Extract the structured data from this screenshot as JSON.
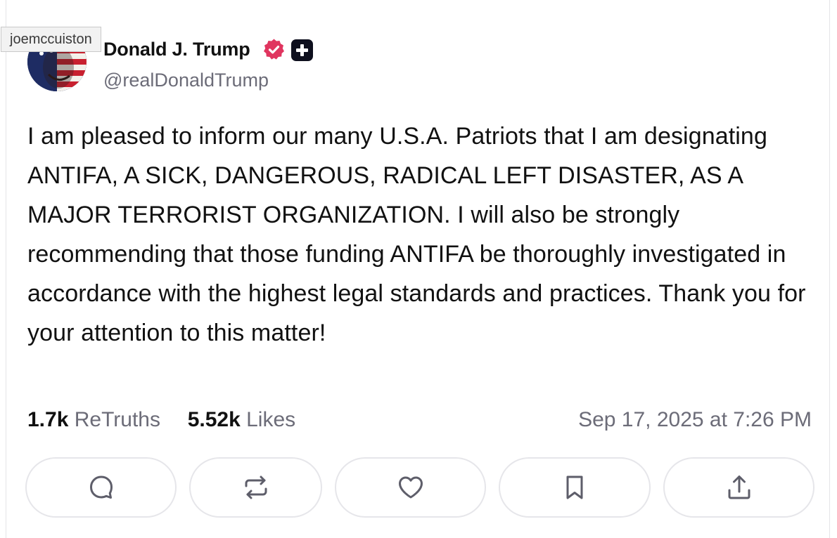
{
  "tooltip": {
    "text": "joemccuiston"
  },
  "author": {
    "display_name": "Donald J. Trump",
    "handle": "@realDonaldTrump",
    "verified_color": "#e0355f"
  },
  "post": {
    "text": "I am pleased to inform our many U.S.A. Patriots that I am designating ANTIFA, A SICK, DANGEROUS, RADICAL LEFT DISASTER, AS A MAJOR TERRORIST ORGANIZATION. I will also be strongly recommending that those funding ANTIFA be thoroughly investigated in accordance with the highest legal standards and practices. Thank you for your attention to this matter!",
    "retruths_count": "1.7k",
    "retruths_label": "ReTruths",
    "likes_count": "5.52k",
    "likes_label": "Likes",
    "timestamp": "Sep 17, 2025 at 7:26 PM"
  },
  "actions": [
    {
      "icon": "comment-icon"
    },
    {
      "icon": "retruth-icon"
    },
    {
      "icon": "like-icon"
    },
    {
      "icon": "bookmark-icon"
    },
    {
      "icon": "share-icon"
    }
  ],
  "colors": {
    "text": "#111111",
    "muted": "#6c6c78",
    "border": "#e6e6ea"
  }
}
